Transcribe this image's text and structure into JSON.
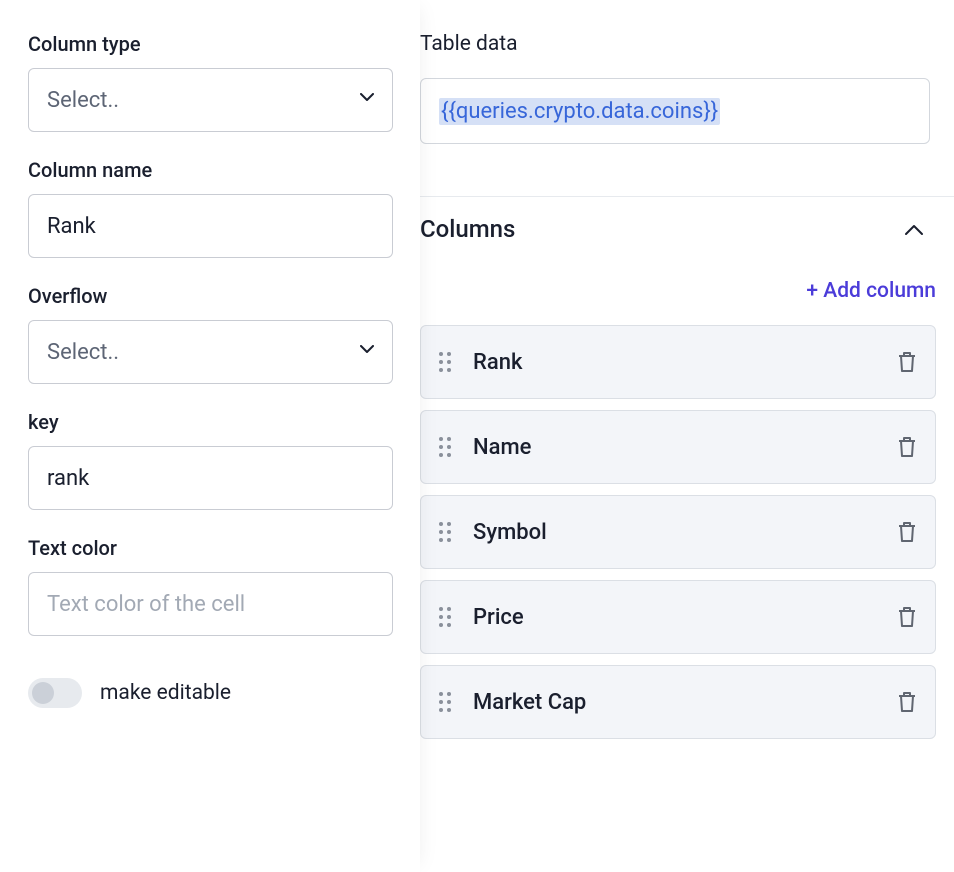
{
  "leftPanel": {
    "columnType": {
      "label": "Column type",
      "placeholder": "Select.."
    },
    "columnName": {
      "label": "Column name",
      "value": "Rank"
    },
    "overflow": {
      "label": "Overflow",
      "placeholder": "Select.."
    },
    "key": {
      "label": "key",
      "value": "rank"
    },
    "textColor": {
      "label": "Text color",
      "placeholder": "Text color of the cell"
    },
    "makeEditable": {
      "label": "make editable",
      "value": false
    }
  },
  "rightPanel": {
    "tableData": {
      "label": "Table data",
      "binding": "{{queries.crypto.data.coins}}"
    },
    "columnsSection": {
      "title": "Columns",
      "addLabel": "+ Add column",
      "items": [
        {
          "label": "Rank"
        },
        {
          "label": "Name"
        },
        {
          "label": "Symbol"
        },
        {
          "label": "Price"
        },
        {
          "label": "Market Cap"
        }
      ]
    }
  }
}
